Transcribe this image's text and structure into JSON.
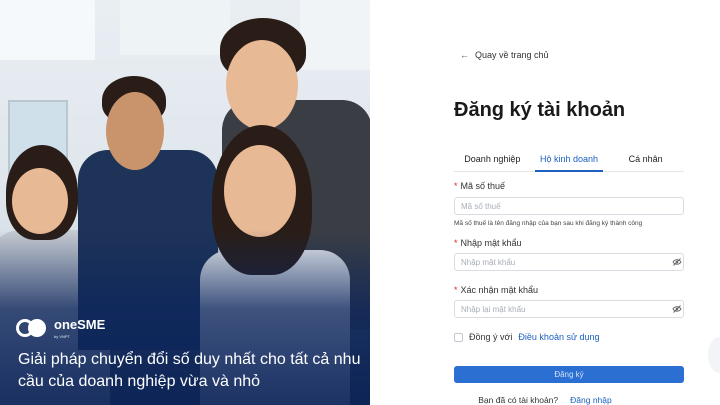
{
  "hero": {
    "brand_name": "oneSME",
    "brand_sub": "by VNPT",
    "tagline": "Giải pháp chuyển đổi số duy nhất cho tất cả nhu cầu của doanh nghiệp vừa và nhỏ"
  },
  "form": {
    "back_link": "Quay về trang chủ",
    "title": "Đăng ký tài khoản",
    "tabs": [
      {
        "label": "Doanh nghiệp",
        "active": false
      },
      {
        "label": "Hộ kinh doanh",
        "active": true
      },
      {
        "label": "Cá nhân",
        "active": false
      }
    ],
    "tax_code": {
      "label": "Mã số thuế",
      "placeholder": "Mã số thuế",
      "hint": "Mã số thuế là tên đăng nhập của bạn sau khi đăng ký thành công"
    },
    "password": {
      "label": "Nhập mật khẩu",
      "placeholder": "Nhập mật khẩu"
    },
    "confirm_password": {
      "label": "Xác nhận mật khẩu",
      "placeholder": "Nhập lại mật khẩu"
    },
    "agree_prefix": "Đồng ý với",
    "agree_link": "Điều khoản sử dụng",
    "submit_label": "Đăng ký",
    "have_account": "Bạn đã có tài khoản?",
    "login_link": "Đăng nhập"
  },
  "colors": {
    "accent": "#1b5fbf",
    "button": "#2a6fd1",
    "hero_overlay": "#0c265c"
  }
}
